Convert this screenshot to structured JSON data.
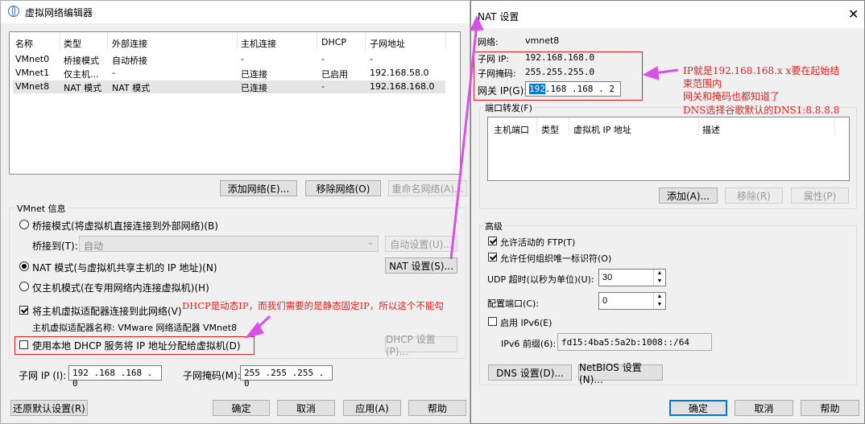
{
  "left": {
    "title": "虚拟网络编辑器",
    "table": {
      "headers": [
        "名称",
        "类型",
        "外部连接",
        "主机连接",
        "DHCP",
        "子网地址"
      ],
      "rows": [
        [
          "VMnet0",
          "桥接模式",
          "自动桥接",
          "-",
          "-",
          "-"
        ],
        [
          "VMnet1",
          "仅主机...",
          "-",
          "已连接",
          "已启用",
          "192.168.58.0"
        ],
        [
          "VMnet8",
          "NAT 模式",
          "NAT 模式",
          "已连接",
          "-",
          "192.168.168.0"
        ]
      ]
    },
    "buttons": {
      "add": "添加网络(E)...",
      "remove": "移除网络(O)",
      "rename": "重命名网络(A)..."
    },
    "vmnet_info": "VMnet 信息",
    "radio_bridge": "桥接模式(将虚拟机直接连接到外部网络)(B)",
    "bridge_to_label": "桥接到(T):",
    "bridge_to_value": "自动",
    "auto_settings": "自动设置(U)...",
    "radio_nat": "NAT 模式(与虚拟机共享主机的 IP 地址)(N)",
    "nat_settings": "NAT 设置(S)...",
    "radio_hostonly": "仅主机模式(在专用网络内连接虚拟机)(H)",
    "connect_adapter": "将主机虚拟适配器连接到此网络(V)",
    "adapter_name": "主机虚拟适配器名称: VMware 网络适配器 VMnet8",
    "use_dhcp": "使用本地 DHCP 服务将 IP 地址分配给虚拟机(D)",
    "dhcp_settings": "DHCP 设置(P)...",
    "subnet_ip_label": "子网 IP (I):",
    "subnet_ip": "192 .168 .168 .  0",
    "subnet_mask_label": "子网掩码(M):",
    "subnet_mask": "255 .255 .255 .  0",
    "restore": "还原默认设置(R)",
    "ok": "确定",
    "cancel": "取消",
    "apply": "应用(A)",
    "help": "帮助"
  },
  "right": {
    "title": "NAT 设置",
    "network_label": "网络:",
    "network_value": "vmnet8",
    "subnet_ip_label": "子网 IP:",
    "subnet_ip": "192.168.168.0",
    "subnet_mask_label": "子网掩码:",
    "subnet_mask": "255.255.255.0",
    "gateway_label": "网关 IP(G):",
    "gateway_sel": "192",
    "gateway_rest": ".168 .168 .  2",
    "port_forward": "端口转发(F)",
    "pf_headers": [
      "主机端口",
      "类型",
      "虚拟机 IP 地址",
      "描述"
    ],
    "pf_add": "添加(A)...",
    "pf_remove": "移除(R)",
    "pf_props": "属性(P)",
    "advanced": "高级",
    "allow_ftp": "允许活动的 FTP(T)",
    "allow_org": "允许任何组织唯一标识符(O)",
    "udp_label": "UDP 超时(以秒为单位)(U):",
    "udp_value": "30",
    "cfg_port_label": "配置端口(C):",
    "cfg_port_value": "0",
    "ipv6": "启用 IPv6(E)",
    "ipv6_prefix_label": "IPv6 前缀(6):",
    "ipv6_prefix": "fd15:4ba5:5a2b:1008::/64",
    "dns": "DNS 设置(D)...",
    "netbios": "NetBIOS 设置(N)...",
    "ok": "确定",
    "cancel": "取消",
    "help": "帮助"
  },
  "annotations": {
    "dhcp_note": "DHCP是动态IP，而我们需要的是静态固定IP，所以这个不能勾",
    "ip_note_1": "IP就是192.168.168.x   x要在起始结",
    "ip_note_2": "束范围内",
    "ip_note_3": "网关和掩码也都知道了",
    "ip_note_4": "DNS选择谷歌默认的DNS1:8.8.8.8"
  },
  "colors": {
    "annotation": "#e02020",
    "arrow": "#d94fe8",
    "accent": "#0078d7"
  }
}
